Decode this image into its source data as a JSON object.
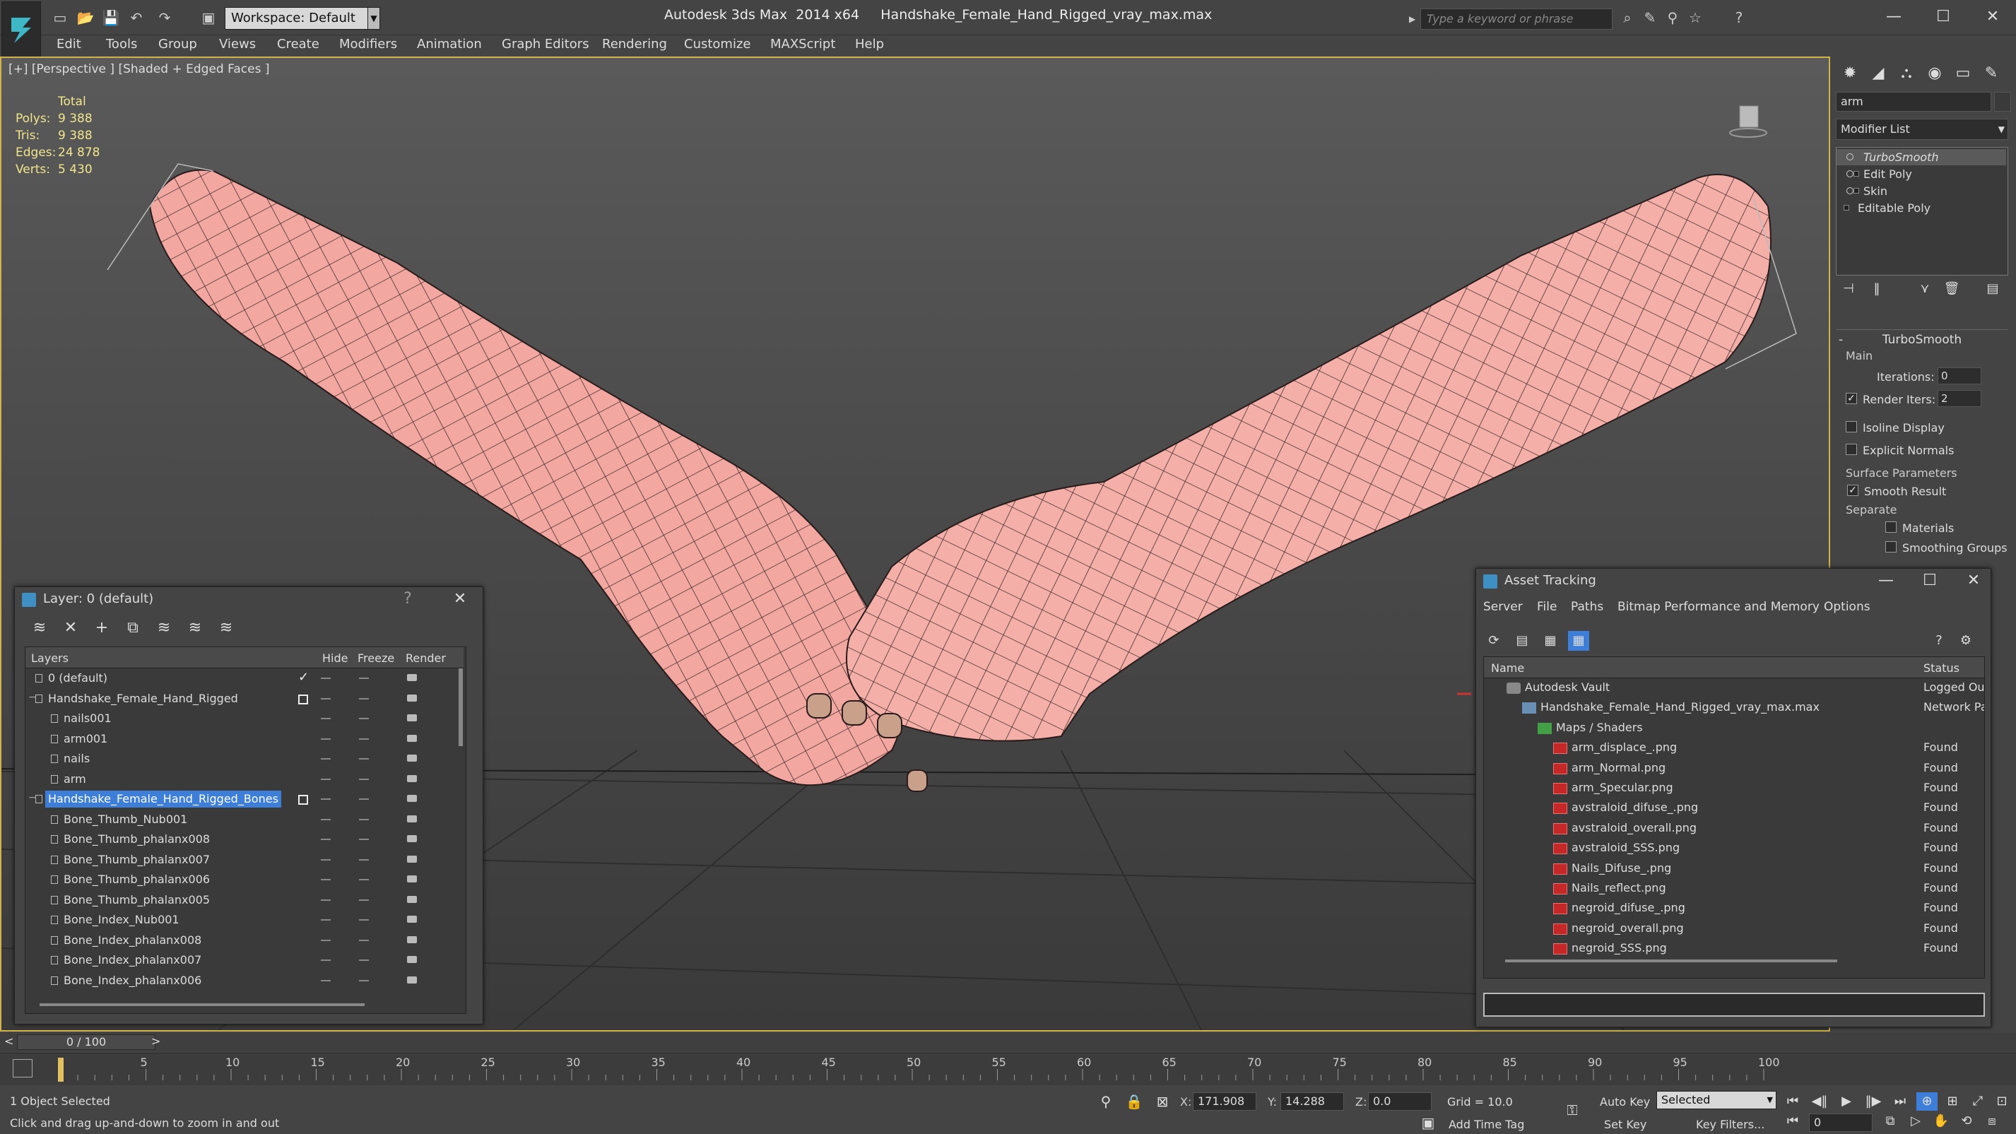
{
  "app": {
    "title": "Autodesk 3ds Max  2014 x64     Handshake_Female_Hand_Rigged_vray_max.max",
    "workspace": "Workspace: Default",
    "search_placeholder": "Type a keyword or phrase"
  },
  "menu": [
    "Edit",
    "Tools",
    "Group",
    "Views",
    "Create",
    "Modifiers",
    "Animation",
    "Graph Editors",
    "Rendering",
    "Customize",
    "MAXScript",
    "Help"
  ],
  "viewport": {
    "label": "[+] [Perspective ] [Shaded + Edged Faces ]",
    "stats": {
      "total_label": "Total",
      "rows": [
        {
          "key": "Polys:",
          "value": "9 388"
        },
        {
          "key": "Tris:",
          "value": "9 388"
        },
        {
          "key": "Edges:",
          "value": "24 878"
        },
        {
          "key": "Verts:",
          "value": "5 430"
        }
      ]
    }
  },
  "command_panel": {
    "object_name": "arm",
    "modifier_list": "Modifier List",
    "stack": [
      "TurboSmooth",
      "Edit Poly",
      "Skin",
      "Editable Poly"
    ],
    "rollout_title": "TurboSmooth",
    "main_label": "Main",
    "iterations_label": "Iterations:",
    "iterations_value": "0",
    "render_iters_label": "Render Iters:",
    "render_iters_value": "2",
    "render_iters_checked": true,
    "isoline_label": "Isoline Display",
    "explicit_label": "Explicit Normals",
    "surface_label": "Surface Parameters",
    "smooth_label": "Smooth Result",
    "smooth_checked": true,
    "separate_label": "Separate",
    "materials_label": "Materials",
    "smoothing_label": "Smoothing Groups"
  },
  "layer_window": {
    "title": "Layer: 0 (default)",
    "help": "?",
    "columns": {
      "layers": "Layers",
      "hide": "Hide",
      "freeze": "Freeze",
      "render": "Render"
    },
    "rows": [
      {
        "name": "0 (default)",
        "indent": 0,
        "current": true
      },
      {
        "name": "Handshake_Female_Hand_Rigged",
        "indent": 0,
        "box": true
      },
      {
        "name": "nails001",
        "indent": 1
      },
      {
        "name": "arm001",
        "indent": 1
      },
      {
        "name": "nails",
        "indent": 1
      },
      {
        "name": "arm",
        "indent": 1
      },
      {
        "name": "Handshake_Female_Hand_Rigged_Bones",
        "indent": 0,
        "box": true,
        "selected": true
      },
      {
        "name": "Bone_Thumb_Nub001",
        "indent": 1
      },
      {
        "name": "Bone_Thumb_phalanx008",
        "indent": 1
      },
      {
        "name": "Bone_Thumb_phalanx007",
        "indent": 1
      },
      {
        "name": "Bone_Thumb_phalanx006",
        "indent": 1
      },
      {
        "name": "Bone_Thumb_phalanx005",
        "indent": 1
      },
      {
        "name": "Bone_Index_Nub001",
        "indent": 1
      },
      {
        "name": "Bone_Index_phalanx008",
        "indent": 1
      },
      {
        "name": "Bone_Index_phalanx007",
        "indent": 1
      },
      {
        "name": "Bone_Index_phalanx006",
        "indent": 1
      }
    ]
  },
  "asset_window": {
    "title": "Asset Tracking",
    "menu": [
      "Server",
      "File",
      "Paths",
      "Bitmap Performance and Memory",
      "Options"
    ],
    "columns": {
      "name": "Name",
      "status": "Status"
    },
    "rows": [
      {
        "name": "Autodesk Vault",
        "status": "Logged Out",
        "indent": 1,
        "icon": "vault"
      },
      {
        "name": "Handshake_Female_Hand_Rigged_vray_max.max",
        "status": "Network Pa",
        "indent": 2,
        "icon": "max"
      },
      {
        "name": "Maps / Shaders",
        "status": "",
        "indent": 3,
        "icon": "maps"
      },
      {
        "name": "arm_displace_.png",
        "status": "Found",
        "indent": 4,
        "icon": "png"
      },
      {
        "name": "arm_Normal.png",
        "status": "Found",
        "indent": 4,
        "icon": "png"
      },
      {
        "name": "arm_Specular.png",
        "status": "Found",
        "indent": 4,
        "icon": "png"
      },
      {
        "name": "avstraloid_difuse_.png",
        "status": "Found",
        "indent": 4,
        "icon": "png"
      },
      {
        "name": "avstraloid_overall.png",
        "status": "Found",
        "indent": 4,
        "icon": "png"
      },
      {
        "name": "avstraloid_SSS.png",
        "status": "Found",
        "indent": 4,
        "icon": "png"
      },
      {
        "name": "Nails_Difuse_.png",
        "status": "Found",
        "indent": 4,
        "icon": "png"
      },
      {
        "name": "Nails_reflect.png",
        "status": "Found",
        "indent": 4,
        "icon": "png"
      },
      {
        "name": "negroid_difuse_.png",
        "status": "Found",
        "indent": 4,
        "icon": "png"
      },
      {
        "name": "negroid_overall.png",
        "status": "Found",
        "indent": 4,
        "icon": "png"
      },
      {
        "name": "negroid_SSS.png",
        "status": "Found",
        "indent": 4,
        "icon": "png"
      }
    ]
  },
  "timeline": {
    "frame_readout": "0 / 100",
    "prev": "<",
    "next": ">",
    "ticks": [
      "5",
      "10",
      "15",
      "20",
      "25",
      "30",
      "35",
      "40",
      "45",
      "50",
      "55",
      "60",
      "65",
      "70",
      "75",
      "80",
      "85",
      "90",
      "95",
      "100"
    ],
    "frame_max": 100,
    "current_frame": 0
  },
  "status": {
    "selection": "1 Object Selected",
    "prompt": "Click and drag up-and-down to zoom in and out",
    "x_label": "X:",
    "x": "171.908",
    "y_label": "Y:",
    "y": "14.288",
    "z_label": "Z:",
    "z": "0.0",
    "grid": "Grid = 10.0",
    "add_time_tag": "Add Time Tag",
    "auto_key": "Auto Key",
    "set_key": "Set Key",
    "selected": "Selected",
    "key_filters": "Key Filters...",
    "frame": "0"
  },
  "colors": {
    "accent": "#3d7fd8",
    "viewport_border": "#d2b24a",
    "stats_text": "#f0e68c",
    "skin": "#f2a8a0",
    "wire": "#3a2a2a"
  }
}
